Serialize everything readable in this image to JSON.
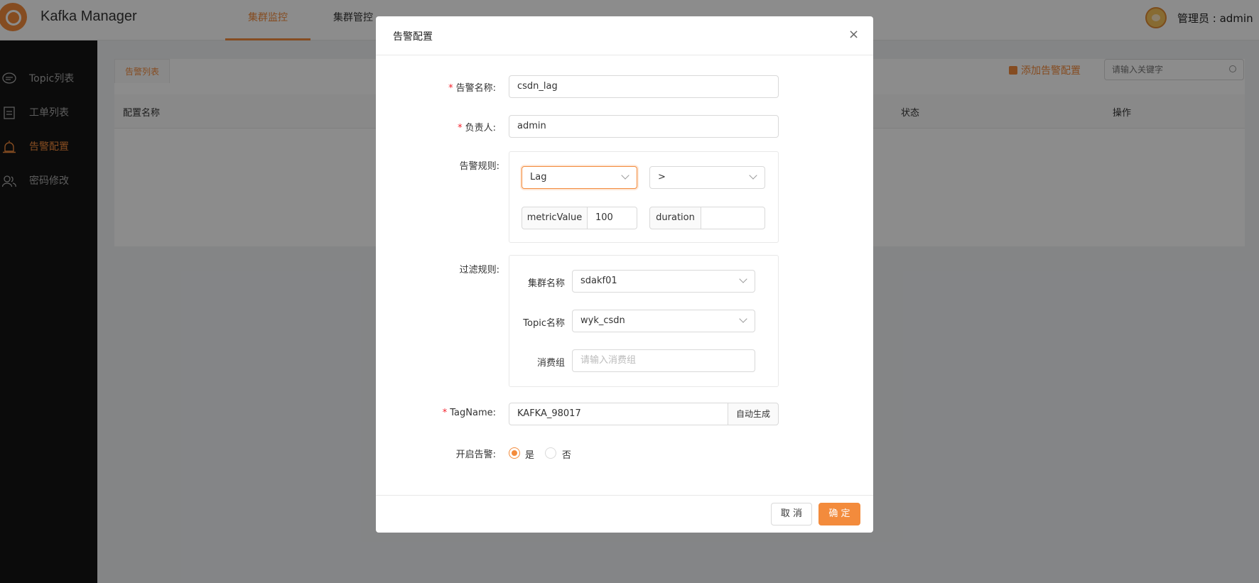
{
  "app": {
    "title": "Kafka Manager"
  },
  "header": {
    "nav_tabs": [
      {
        "label": "集群监控",
        "active": true
      },
      {
        "label": "集群管控",
        "active": false
      }
    ],
    "user_label": "管理员 : admin"
  },
  "sidebar": {
    "items": [
      {
        "label": "Topic列表",
        "icon": "chat-icon",
        "active": false
      },
      {
        "label": "工单列表",
        "icon": "clipboard-icon",
        "active": false
      },
      {
        "label": "告警配置",
        "icon": "alarm-icon",
        "active": true
      },
      {
        "label": "密码修改",
        "icon": "users-icon",
        "active": false
      }
    ]
  },
  "page": {
    "tab_label": "告警列表",
    "add_button": "添加告警配置",
    "search_placeholder": "请输入关键字",
    "table_headers": [
      "配置名称",
      "状态",
      "操作"
    ]
  },
  "modal": {
    "title": "告警配置",
    "close": "×",
    "fields": {
      "name": {
        "label": "告警名称:",
        "value": "csdn_lag",
        "required": true
      },
      "owner": {
        "label": "负责人:",
        "value": "admin",
        "required": true
      },
      "rule": {
        "label": "告警规则:",
        "metric_select": "Lag",
        "operator_select": ">",
        "metric_value_addon": "metricValue",
        "metric_value": "100",
        "duration_addon": "duration",
        "duration_value": ""
      },
      "filter": {
        "label": "过滤规则:",
        "cluster_label": "集群名称",
        "cluster_value": "sdakf01",
        "topic_label": "Topic名称",
        "topic_value": "wyk_csdn",
        "consumer_label": "消费组",
        "consumer_placeholder": "请输入消费组"
      },
      "tag": {
        "label": "TagName:",
        "value": "KAFKA_98017",
        "required": true,
        "auto_button": "自动生成"
      },
      "enable": {
        "label": "开启告警:",
        "yes": "是",
        "no": "否",
        "selected": "是"
      }
    },
    "footer": {
      "cancel": "取 消",
      "confirm": "确 定"
    }
  },
  "colors": {
    "accent": "#f38b3c",
    "sidebar_bg": "#141414",
    "required": "#f5222d"
  }
}
